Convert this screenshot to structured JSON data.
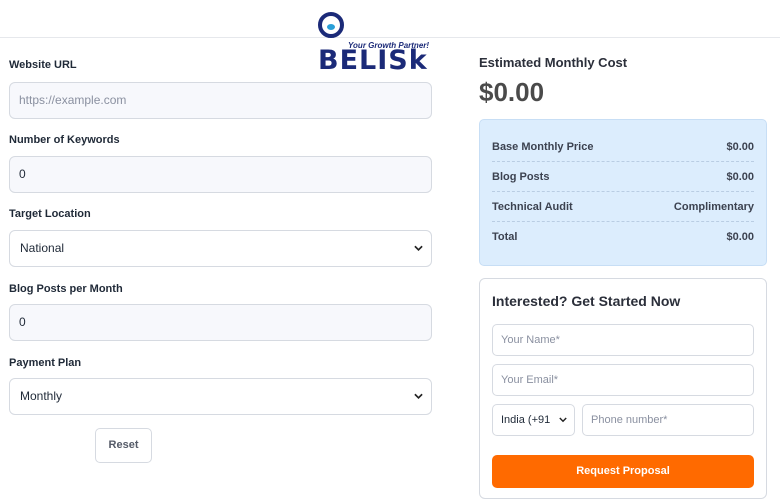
{
  "brand": {
    "logo_text": "OBELISk",
    "logo_rest": "BELISk",
    "tagline": "Your Growth Partner!",
    "colors": {
      "navy": "#1b2a78",
      "accent": "#2a9fd8"
    }
  },
  "form": {
    "website_url": {
      "label": "Website URL",
      "placeholder": "https://example.com",
      "value": ""
    },
    "keywords": {
      "label": "Number of Keywords",
      "value": "0"
    },
    "location": {
      "label": "Target Location",
      "selected": "National"
    },
    "blog_posts": {
      "label": "Blog Posts per Month",
      "value": "0"
    },
    "payment_plan": {
      "label": "Payment Plan",
      "selected": "Monthly"
    },
    "reset_label": "Reset"
  },
  "estimate": {
    "title": "Estimated Monthly Cost",
    "value": "$0.00",
    "rows": [
      {
        "label": "Base Monthly Price",
        "value": "$0.00"
      },
      {
        "label": "Blog Posts",
        "value": "$0.00"
      },
      {
        "label": "Technical Audit",
        "value": "Complimentary"
      },
      {
        "label": "Total",
        "value": "$0.00"
      }
    ],
    "box_color": "#dcedfd"
  },
  "lead_form": {
    "title": "Interested? Get Started Now",
    "name_placeholder": "Your Name*",
    "email_placeholder": "Your Email*",
    "country_code": "India (+91",
    "phone_placeholder": "Phone number*",
    "submit_label": "Request Proposal",
    "submit_color": "#ff6a00"
  }
}
